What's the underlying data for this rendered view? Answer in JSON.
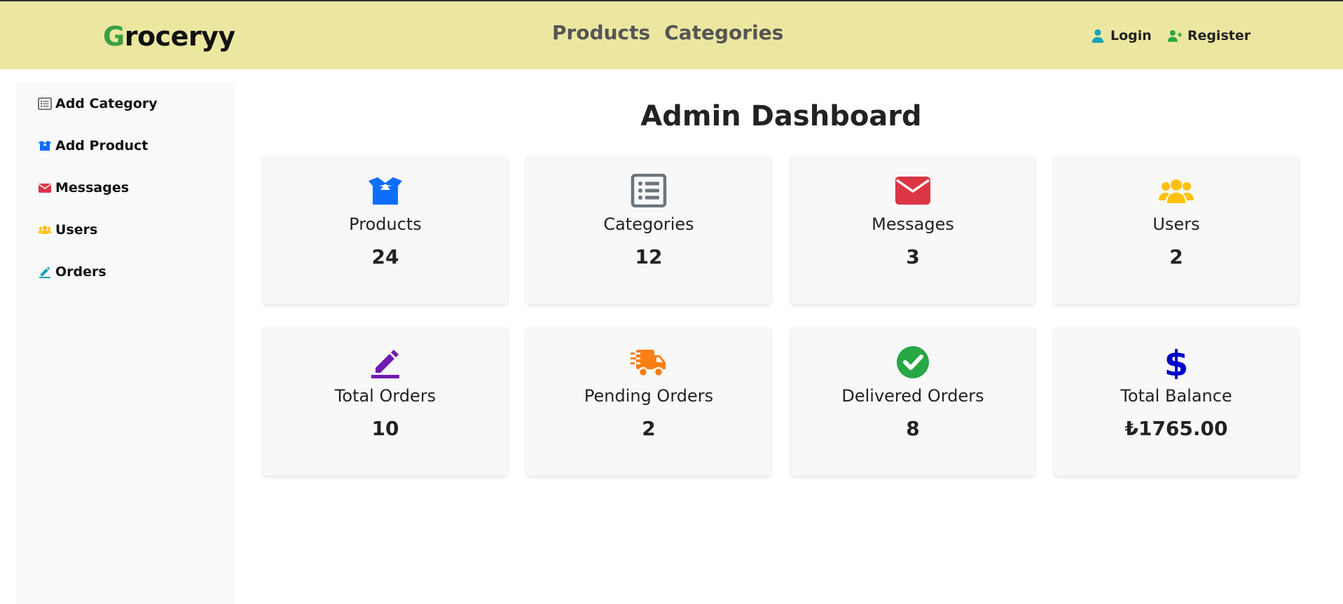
{
  "navbar": {
    "brand_first": "G",
    "brand_rest": "roceryy",
    "links": [
      "Products",
      "Categories"
    ],
    "login_label": "Login",
    "register_label": "Register"
  },
  "sidebar": {
    "items": [
      {
        "label": "Add Category",
        "icon": "list-icon",
        "color": "#6c757d"
      },
      {
        "label": "Add Product",
        "icon": "box-open-icon",
        "color": "#0d6efd"
      },
      {
        "label": "Messages",
        "icon": "envelope-icon",
        "color": "#dc3545"
      },
      {
        "label": "Users",
        "icon": "users-icon",
        "color": "#ffc107"
      },
      {
        "label": "Orders",
        "icon": "pen-icon",
        "color": "#17a2b8"
      }
    ]
  },
  "main": {
    "title": "Admin Dashboard",
    "cards": [
      {
        "label": "Products",
        "value": "24",
        "icon": "box-open-icon",
        "color": "#0d6efd"
      },
      {
        "label": "Categories",
        "value": "12",
        "icon": "list-icon",
        "color": "#6c757d"
      },
      {
        "label": "Messages",
        "value": "3",
        "icon": "envelope-icon",
        "color": "#dc3545"
      },
      {
        "label": "Users",
        "value": "2",
        "icon": "users-icon",
        "color": "#ffc107"
      },
      {
        "label": "Total Orders",
        "value": "10",
        "icon": "pen-icon",
        "color": "#6f1ab1"
      },
      {
        "label": "Pending Orders",
        "value": "2",
        "icon": "truck-fast-icon",
        "color": "#fd7e14"
      },
      {
        "label": "Delivered Orders",
        "value": "8",
        "icon": "check-circle-icon",
        "color": "#28a745"
      },
      {
        "label": "Total Balance",
        "value": "₺1765.00",
        "icon": "dollar-icon",
        "color": "#0000cc"
      }
    ]
  },
  "colors": {
    "navbar_bg": "#ece7a0",
    "brand_accent": "#3aa043",
    "login_icon": "#17a2b8",
    "register_icon": "#28a745"
  }
}
